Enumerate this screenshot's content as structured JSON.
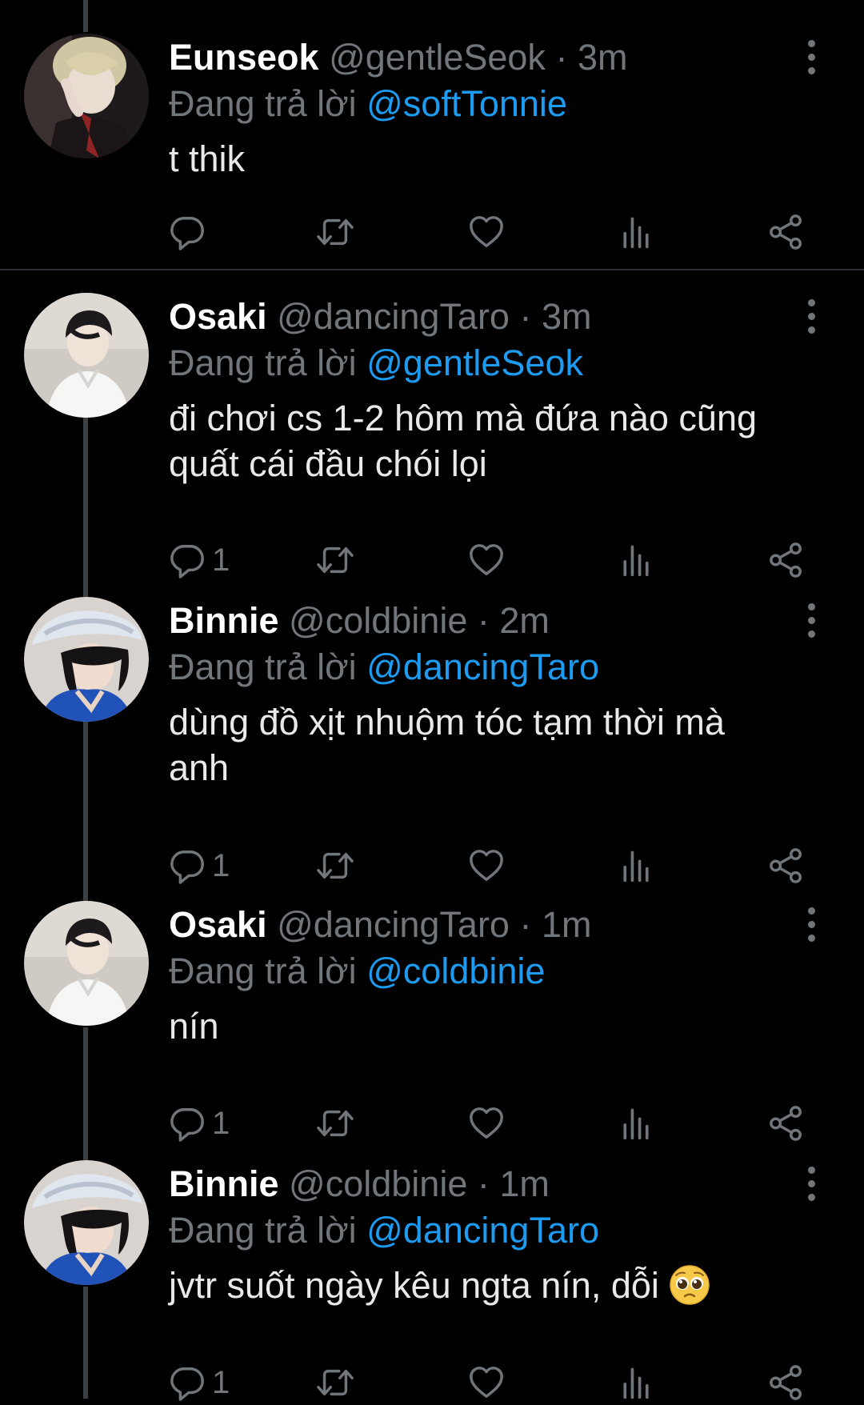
{
  "colors": {
    "background": "#000000",
    "text": "#e7e9ea",
    "muted": "#71767b",
    "mention": "#1d9bf0",
    "thread_line": "#3a3f44"
  },
  "reply_prefix": "Đang trả lời",
  "tweets": [
    {
      "display_name": "Eunseok",
      "handle": "@gentleSeok",
      "separator": "·",
      "time": "3m",
      "reply_to": "@softTonnie",
      "text": "t thik",
      "reply_count": ""
    },
    {
      "display_name": "Osaki",
      "handle": "@dancingTaro",
      "separator": "·",
      "time": "3m",
      "reply_to": "@gentleSeok",
      "text_lines": [
        "đi chơi cs 1-2 hôm mà đứa nào cũng",
        "quất cái đầu chói lọi"
      ],
      "reply_count": "1"
    },
    {
      "display_name": "Binnie",
      "handle": "@coldbinie",
      "separator": "·",
      "time": "2m",
      "reply_to": "@dancingTaro",
      "text_lines": [
        "dùng đồ xịt nhuộm tóc tạm thời mà",
        "anh"
      ],
      "reply_count": "1"
    },
    {
      "display_name": "Osaki",
      "handle": "@dancingTaro",
      "separator": "·",
      "time": "1m",
      "reply_to": "@coldbinie",
      "text": "nín",
      "reply_count": "1"
    },
    {
      "display_name": "Binnie",
      "handle": "@coldbinie",
      "separator": "·",
      "time": "1m",
      "reply_to": "@dancingTaro",
      "text": "jvtr suốt ngày kêu ngta nín, dỗi",
      "emoji": "pleading-face-emoji",
      "reply_count": "1"
    }
  ],
  "icons": [
    "reply-icon",
    "retweet-icon",
    "like-icon",
    "views-icon",
    "share-icon",
    "more-icon"
  ]
}
